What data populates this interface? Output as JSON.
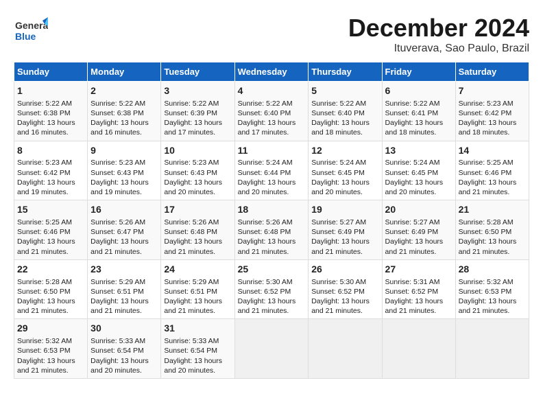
{
  "header": {
    "logo_general": "General",
    "logo_blue": "Blue",
    "month_title": "December 2024",
    "location": "Ituverava, Sao Paulo, Brazil"
  },
  "columns": [
    "Sunday",
    "Monday",
    "Tuesday",
    "Wednesday",
    "Thursday",
    "Friday",
    "Saturday"
  ],
  "weeks": [
    [
      {
        "day": "1",
        "sunrise": "Sunrise: 5:22 AM",
        "sunset": "Sunset: 6:38 PM",
        "daylight": "Daylight: 13 hours and 16 minutes."
      },
      {
        "day": "2",
        "sunrise": "Sunrise: 5:22 AM",
        "sunset": "Sunset: 6:38 PM",
        "daylight": "Daylight: 13 hours and 16 minutes."
      },
      {
        "day": "3",
        "sunrise": "Sunrise: 5:22 AM",
        "sunset": "Sunset: 6:39 PM",
        "daylight": "Daylight: 13 hours and 17 minutes."
      },
      {
        "day": "4",
        "sunrise": "Sunrise: 5:22 AM",
        "sunset": "Sunset: 6:40 PM",
        "daylight": "Daylight: 13 hours and 17 minutes."
      },
      {
        "day": "5",
        "sunrise": "Sunrise: 5:22 AM",
        "sunset": "Sunset: 6:40 PM",
        "daylight": "Daylight: 13 hours and 18 minutes."
      },
      {
        "day": "6",
        "sunrise": "Sunrise: 5:22 AM",
        "sunset": "Sunset: 6:41 PM",
        "daylight": "Daylight: 13 hours and 18 minutes."
      },
      {
        "day": "7",
        "sunrise": "Sunrise: 5:23 AM",
        "sunset": "Sunset: 6:42 PM",
        "daylight": "Daylight: 13 hours and 18 minutes."
      }
    ],
    [
      {
        "day": "8",
        "sunrise": "Sunrise: 5:23 AM",
        "sunset": "Sunset: 6:42 PM",
        "daylight": "Daylight: 13 hours and 19 minutes."
      },
      {
        "day": "9",
        "sunrise": "Sunrise: 5:23 AM",
        "sunset": "Sunset: 6:43 PM",
        "daylight": "Daylight: 13 hours and 19 minutes."
      },
      {
        "day": "10",
        "sunrise": "Sunrise: 5:23 AM",
        "sunset": "Sunset: 6:43 PM",
        "daylight": "Daylight: 13 hours and 20 minutes."
      },
      {
        "day": "11",
        "sunrise": "Sunrise: 5:24 AM",
        "sunset": "Sunset: 6:44 PM",
        "daylight": "Daylight: 13 hours and 20 minutes."
      },
      {
        "day": "12",
        "sunrise": "Sunrise: 5:24 AM",
        "sunset": "Sunset: 6:45 PM",
        "daylight": "Daylight: 13 hours and 20 minutes."
      },
      {
        "day": "13",
        "sunrise": "Sunrise: 5:24 AM",
        "sunset": "Sunset: 6:45 PM",
        "daylight": "Daylight: 13 hours and 20 minutes."
      },
      {
        "day": "14",
        "sunrise": "Sunrise: 5:25 AM",
        "sunset": "Sunset: 6:46 PM",
        "daylight": "Daylight: 13 hours and 21 minutes."
      }
    ],
    [
      {
        "day": "15",
        "sunrise": "Sunrise: 5:25 AM",
        "sunset": "Sunset: 6:46 PM",
        "daylight": "Daylight: 13 hours and 21 minutes."
      },
      {
        "day": "16",
        "sunrise": "Sunrise: 5:26 AM",
        "sunset": "Sunset: 6:47 PM",
        "daylight": "Daylight: 13 hours and 21 minutes."
      },
      {
        "day": "17",
        "sunrise": "Sunrise: 5:26 AM",
        "sunset": "Sunset: 6:48 PM",
        "daylight": "Daylight: 13 hours and 21 minutes."
      },
      {
        "day": "18",
        "sunrise": "Sunrise: 5:26 AM",
        "sunset": "Sunset: 6:48 PM",
        "daylight": "Daylight: 13 hours and 21 minutes."
      },
      {
        "day": "19",
        "sunrise": "Sunrise: 5:27 AM",
        "sunset": "Sunset: 6:49 PM",
        "daylight": "Daylight: 13 hours and 21 minutes."
      },
      {
        "day": "20",
        "sunrise": "Sunrise: 5:27 AM",
        "sunset": "Sunset: 6:49 PM",
        "daylight": "Daylight: 13 hours and 21 minutes."
      },
      {
        "day": "21",
        "sunrise": "Sunrise: 5:28 AM",
        "sunset": "Sunset: 6:50 PM",
        "daylight": "Daylight: 13 hours and 21 minutes."
      }
    ],
    [
      {
        "day": "22",
        "sunrise": "Sunrise: 5:28 AM",
        "sunset": "Sunset: 6:50 PM",
        "daylight": "Daylight: 13 hours and 21 minutes."
      },
      {
        "day": "23",
        "sunrise": "Sunrise: 5:29 AM",
        "sunset": "Sunset: 6:51 PM",
        "daylight": "Daylight: 13 hours and 21 minutes."
      },
      {
        "day": "24",
        "sunrise": "Sunrise: 5:29 AM",
        "sunset": "Sunset: 6:51 PM",
        "daylight": "Daylight: 13 hours and 21 minutes."
      },
      {
        "day": "25",
        "sunrise": "Sunrise: 5:30 AM",
        "sunset": "Sunset: 6:52 PM",
        "daylight": "Daylight: 13 hours and 21 minutes."
      },
      {
        "day": "26",
        "sunrise": "Sunrise: 5:30 AM",
        "sunset": "Sunset: 6:52 PM",
        "daylight": "Daylight: 13 hours and 21 minutes."
      },
      {
        "day": "27",
        "sunrise": "Sunrise: 5:31 AM",
        "sunset": "Sunset: 6:52 PM",
        "daylight": "Daylight: 13 hours and 21 minutes."
      },
      {
        "day": "28",
        "sunrise": "Sunrise: 5:32 AM",
        "sunset": "Sunset: 6:53 PM",
        "daylight": "Daylight: 13 hours and 21 minutes."
      }
    ],
    [
      {
        "day": "29",
        "sunrise": "Sunrise: 5:32 AM",
        "sunset": "Sunset: 6:53 PM",
        "daylight": "Daylight: 13 hours and 21 minutes."
      },
      {
        "day": "30",
        "sunrise": "Sunrise: 5:33 AM",
        "sunset": "Sunset: 6:54 PM",
        "daylight": "Daylight: 13 hours and 20 minutes."
      },
      {
        "day": "31",
        "sunrise": "Sunrise: 5:33 AM",
        "sunset": "Sunset: 6:54 PM",
        "daylight": "Daylight: 13 hours and 20 minutes."
      },
      null,
      null,
      null,
      null
    ]
  ]
}
